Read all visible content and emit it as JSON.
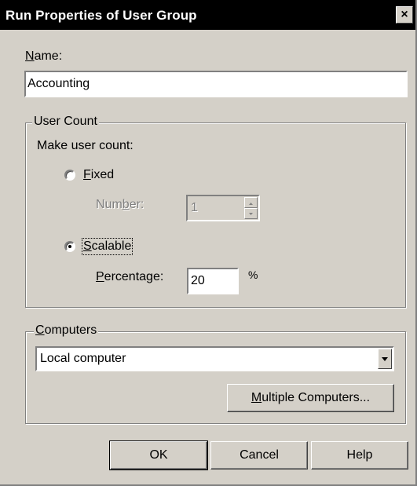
{
  "window": {
    "title": "Run Properties of User Group",
    "close_label": "×"
  },
  "name": {
    "label": "Name:",
    "mnemonic": "N",
    "label_rest": "ame:",
    "value": "Accounting"
  },
  "user_count": {
    "title": "User Count",
    "make_label": "Make user count:",
    "fixed": {
      "label": "Fixed",
      "mnemonic": "F",
      "rest": "ixed",
      "selected": false
    },
    "number": {
      "pre": "Num",
      "mnemonic": "b",
      "rest": "er:",
      "value": "1",
      "disabled": true
    },
    "scalable": {
      "label": "Scalable",
      "mnemonic": "S",
      "rest": "calable",
      "selected": true
    },
    "percentage": {
      "mnemonic": "P",
      "rest": "ercentage:",
      "value": "20",
      "unit": "%"
    }
  },
  "computers": {
    "title_mnemonic": "C",
    "title_rest": "omputers",
    "selected": "Local computer",
    "multiple_button": {
      "mnemonic": "M",
      "rest": "ultiple Computers..."
    }
  },
  "buttons": {
    "ok": "OK",
    "cancel": "Cancel",
    "help": "Help"
  }
}
